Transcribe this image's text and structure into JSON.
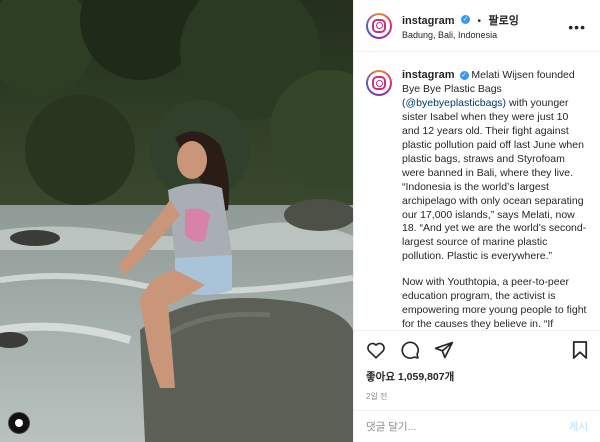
{
  "post": {
    "username": "instagram",
    "follow_separator": "•",
    "follow_label": "팔로잉",
    "location": "Badung, Bali, Indonesia",
    "more_label": "•••",
    "caption_p1_text": "Melati Wijsen founded Bye Bye Plastic Bags",
    "caption_p1_link": "(@byebyeplasticbags)",
    "caption_p1_rest": "with younger sister Isabel when they were just 10 and 12 years old. Their fight against plastic pollution paid off last June when plastic bags, straws and Styrofoam were banned in Bali, where they live. “Indonesia is the world’s largest archipelago with only ocean separating our 17,000 islands,” says Melati, now 18. “And yet we are the world’s second-largest source of marine plastic pollution. Plastic is everywhere.”",
    "caption_p2": "Now with Youthtopia, a peer-to-peer education program, the activist is empowering more young people to fight for the causes they believe in. “If",
    "likes_text": "좋아요 1,059,807개",
    "time_text": "2일 전",
    "comment_placeholder": "댓글 달기...",
    "post_button": "게시"
  },
  "icons": [
    "heart-icon",
    "comment-icon",
    "share-icon",
    "bookmark-icon",
    "instagram-logo-icon",
    "verified-badge-icon"
  ]
}
